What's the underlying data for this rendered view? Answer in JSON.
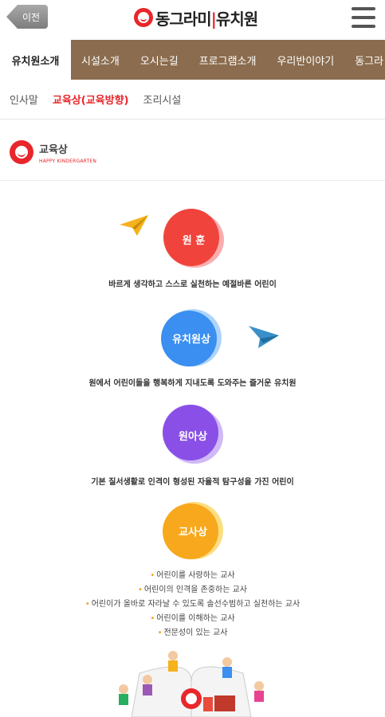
{
  "header": {
    "back_label": "이전",
    "logo_text_a": "동그라미",
    "logo_text_b": "유치원"
  },
  "main_nav": [
    {
      "label": "유치원소개",
      "active": true
    },
    {
      "label": "시설소개",
      "active": false
    },
    {
      "label": "오시는길",
      "active": false
    },
    {
      "label": "프로그램소개",
      "active": false
    },
    {
      "label": "우리반이야기",
      "active": false
    },
    {
      "label": "동그라",
      "active": false
    }
  ],
  "sub_nav": [
    {
      "label": "인사말",
      "active": false
    },
    {
      "label": "교육상(교육방향)",
      "active": true
    },
    {
      "label": "조리시설",
      "active": false
    }
  ],
  "section": {
    "title": "교육상",
    "subtitle": "HAPPY KINDERGARTEN"
  },
  "items": [
    {
      "label": "원 훈",
      "desc": "바르게 생각하고 스스로 실천하는 예절바른 어린이",
      "color": "#f0433b"
    },
    {
      "label": "유치원상",
      "desc": "원에서 어린이들을 행복하게 지내도록 도와주는 즐거운 유치원",
      "color": "#3a8ff0"
    },
    {
      "label": "원아상",
      "desc": "기본 질서생활로 인격이 형성된 자율적 탐구성을 가진 어린이",
      "color": "#8a4fe6"
    },
    {
      "label": "교사상",
      "color": "#f8a81c"
    }
  ],
  "teacher_points": [
    "어린이를 사랑하는 교사",
    "어린이의 인격을 존중하는 교사",
    "어린이가 올바로 자라날 수 있도록 솔선수범하고 실천하는 교사",
    "어린이를 이해하는 교사",
    "전문성이 있는 교사"
  ],
  "colors": {
    "brand_red": "#e8262b",
    "nav_brown": "#8b6c4e",
    "plane_yellow": "#f5b21c",
    "plane_blue": "#3a8fc8"
  }
}
